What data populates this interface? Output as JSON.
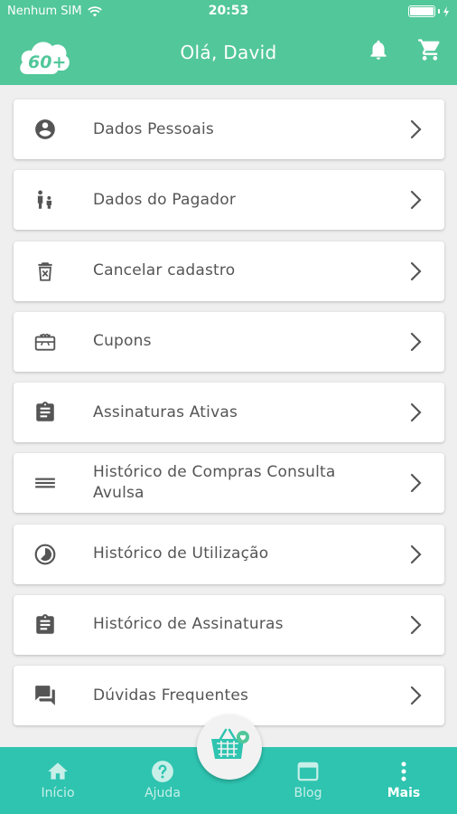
{
  "status_bar": {
    "carrier": "Nenhum SIM",
    "time": "20:53"
  },
  "header": {
    "logo_text": "60+",
    "greeting": "Olá, David"
  },
  "menu": [
    {
      "label": "Dados Pessoais",
      "icon": "person-circle-icon"
    },
    {
      "label": "Dados do Pagador",
      "icon": "payer-people-icon"
    },
    {
      "label": "Cancelar cadastro",
      "icon": "trash-icon"
    },
    {
      "label": "Cupons",
      "icon": "gift-card-icon"
    },
    {
      "label": "Assinaturas Ativas",
      "icon": "clipboard-icon"
    },
    {
      "label": "Histórico de Compras Consulta Avulsa",
      "icon": "list-lines-icon"
    },
    {
      "label": "Histórico de Utilização",
      "icon": "clock-pie-icon"
    },
    {
      "label": "Histórico de Assinaturas",
      "icon": "clipboard-icon"
    },
    {
      "label": "Dúvidas Frequentes",
      "icon": "chat-bubbles-icon"
    }
  ],
  "tabs": [
    {
      "label": "Início",
      "icon": "home-icon"
    },
    {
      "label": "Ajuda",
      "icon": "help-icon"
    },
    {
      "label": "Blog",
      "icon": "browser-icon"
    },
    {
      "label": "Mais",
      "icon": "more-vertical-icon"
    }
  ],
  "colors": {
    "header": "#52c79a",
    "tabbar": "#2ec4b0",
    "icon": "#555555",
    "text": "#555555"
  }
}
